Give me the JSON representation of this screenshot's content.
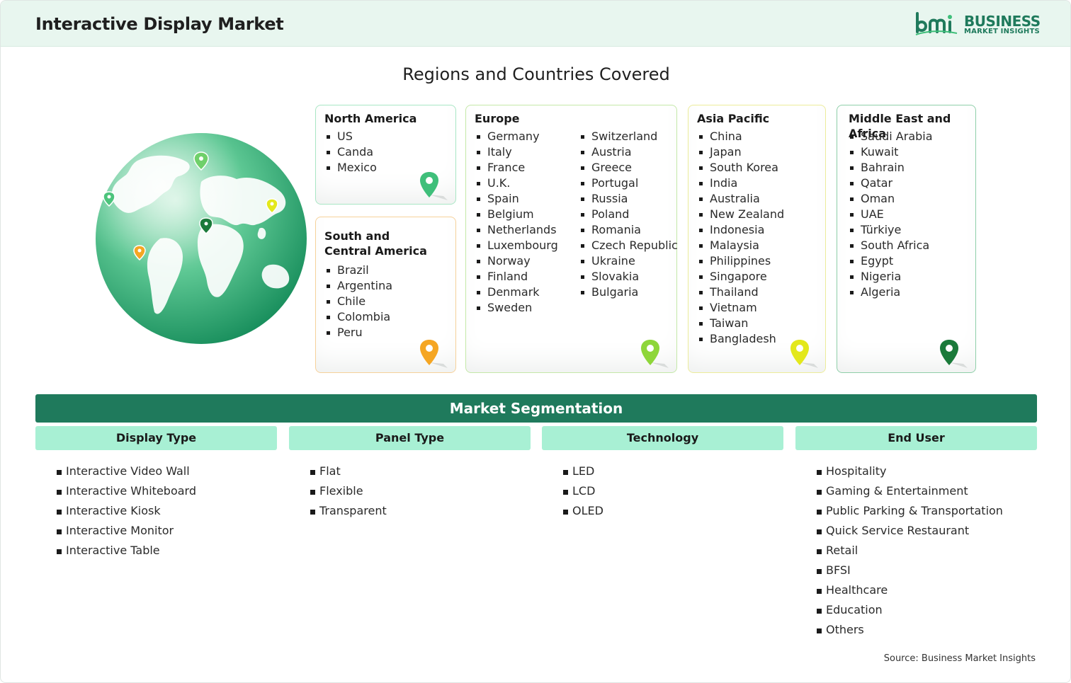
{
  "header": {
    "title": "Interactive Display Market"
  },
  "logo": {
    "word1": "BUSINESS",
    "word2": "MARKET INSIGHTS",
    "mark": "bmi"
  },
  "regions_title": "Regions and Countries Covered",
  "regions": {
    "north_america": {
      "title": "North America",
      "countries": [
        "US",
        "Canda",
        "Mexico"
      ],
      "pin_color": "#3fbf7a"
    },
    "south_central_america": {
      "title_line1": "South and",
      "title_line2": "Central America",
      "countries": [
        "Brazil",
        "Argentina",
        "Chile",
        "Colombia",
        "Peru"
      ],
      "pin_color": "#f5a623"
    },
    "europe": {
      "title": "Europe",
      "countries_col1": [
        "Germany",
        "Italy",
        "France",
        "U.K.",
        "Spain",
        "Belgium",
        "Netherlands",
        "Luxembourg",
        "Norway",
        "Finland",
        "Denmark",
        "Sweden"
      ],
      "countries_col2": [
        "Switzerland",
        "Austria",
        "Greece",
        "Portugal",
        "Russia",
        "Poland",
        "Romania",
        "Czech Republic",
        "Ukraine",
        "Slovakia",
        "Bulgaria"
      ],
      "pin_color": "#8ed63a"
    },
    "asia_pacific": {
      "title": "Asia Pacific",
      "countries": [
        "China",
        "Japan",
        "South Korea",
        "India",
        "Australia",
        "New Zealand",
        "Indonesia",
        "Malaysia",
        "Philippines",
        "Singapore",
        "Thailand",
        "Vietnam",
        "Taiwan",
        "Bangladesh"
      ],
      "pin_color": "#e3e81c"
    },
    "mea": {
      "title": "Middle East and Africa",
      "countries": [
        "Saudi Arabia",
        "Kuwait",
        "Bahrain",
        "Qatar",
        "Oman",
        "UAE",
        "Türkiye",
        "South Africa",
        "Egypt",
        "Nigeria",
        "Algeria"
      ],
      "pin_color": "#1b7a3a"
    }
  },
  "segmentation": {
    "title": "Market Segmentation",
    "columns": [
      {
        "heading": "Display Type",
        "items": [
          "Interactive Video Wall",
          "Interactive Whiteboard",
          "Interactive Kiosk",
          "Interactive Monitor",
          "Interactive Table"
        ]
      },
      {
        "heading": "Panel Type",
        "items": [
          "Flat",
          "Flexible",
          "Transparent"
        ]
      },
      {
        "heading": "Technology",
        "items": [
          "LED",
          "LCD",
          "OLED"
        ]
      },
      {
        "heading": "End User",
        "items": [
          "Hospitality",
          "Gaming & Entertainment",
          "Public Parking & Transportation",
          "Quick Service Restaurant",
          "Retail",
          "BFSI",
          "Healthcare",
          "Education",
          "Others"
        ]
      }
    ]
  },
  "source": "Source: Business Market Insights",
  "colors": {
    "brand": "#1f7a5c",
    "header_bg": "#e8f6ef",
    "segment_head": "#a8f0d4"
  }
}
